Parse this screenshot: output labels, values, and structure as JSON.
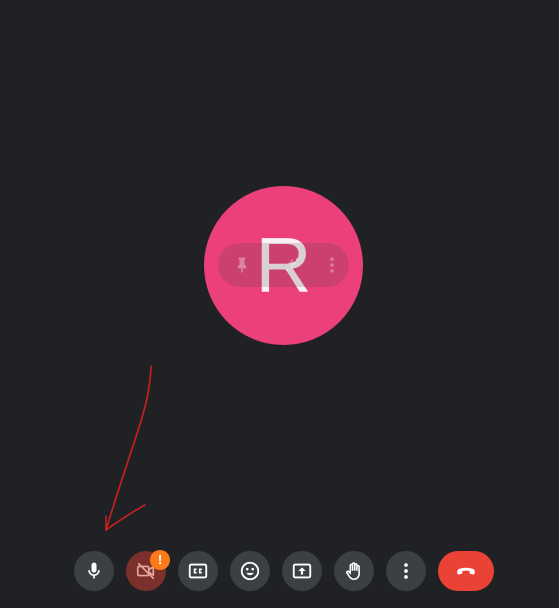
{
  "participant": {
    "initial": "R",
    "avatar_color": "#ec407a"
  },
  "tile_overlay": {
    "icons": [
      "pin-icon",
      "audio-effects-icon",
      "more-options-icon"
    ]
  },
  "annotation": {
    "type": "hand-drawn-arrow",
    "color": "#cc1f1f"
  },
  "camera": {
    "warning_badge": "!"
  },
  "toolbar": {
    "buttons": [
      {
        "name": "microphone-button",
        "icon": "mic-icon"
      },
      {
        "name": "camera-button",
        "icon": "camera-off-icon",
        "state": "error"
      },
      {
        "name": "captions-button",
        "icon": "cc-icon"
      },
      {
        "name": "reactions-button",
        "icon": "emoji-icon"
      },
      {
        "name": "present-button",
        "icon": "present-screen-icon"
      },
      {
        "name": "raise-hand-button",
        "icon": "hand-icon"
      },
      {
        "name": "more-options-button",
        "icon": "more-vert-icon"
      },
      {
        "name": "end-call-button",
        "icon": "call-end-icon"
      }
    ],
    "colors": {
      "button_bg": "#3c4043",
      "end_call": "#ea4335",
      "badge": "#fa7b17"
    }
  }
}
